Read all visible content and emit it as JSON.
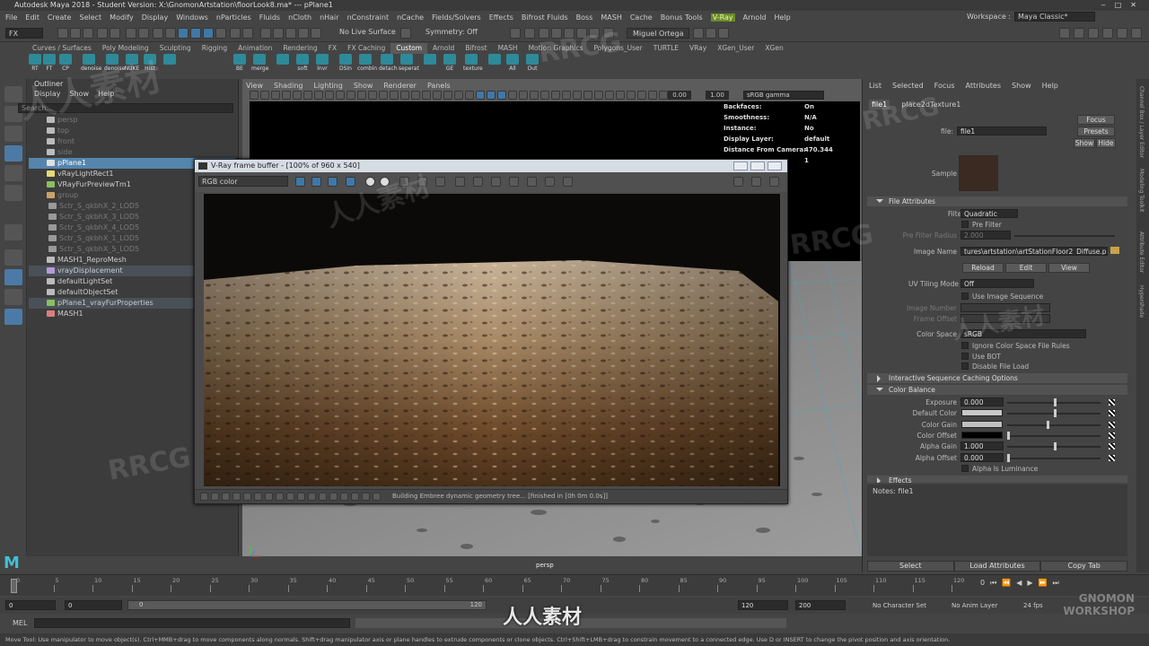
{
  "window": {
    "title": "Autodesk Maya 2018 - Student Version: X:\\GnomonArtstation\\floorLook8.ma*   ---   pPlane1"
  },
  "menus": [
    "File",
    "Edit",
    "Create",
    "Select",
    "Modify",
    "Display",
    "Windows",
    "nParticles",
    "Fluids",
    "nCloth",
    "nHair",
    "nConstraint",
    "nCache",
    "Fields/Solvers",
    "Effects",
    "Bifrost Fluids",
    "Boss",
    "MASH",
    "Cache",
    "Bonus Tools",
    "V-Ray",
    "Arnold",
    "Help"
  ],
  "workspace": {
    "label": "Workspace :",
    "value": "Maya Classic*"
  },
  "statusline": {
    "mode": "FX",
    "live_surface": "No Live Surface",
    "symmetry": "Symmetry: Off",
    "user": "Miguel Ortega"
  },
  "shelf": {
    "tabs": [
      "Curves / Surfaces",
      "Poly Modeling",
      "Sculpting",
      "Rigging",
      "Animation",
      "Rendering",
      "FX",
      "FX Caching",
      "Custom",
      "Arnold",
      "Bifrost",
      "MASH",
      "Motion Graphics",
      "Polygons_User",
      "TURTLE",
      "VRay",
      "XGen_User",
      "XGen"
    ],
    "active_tab": "Custom",
    "buttons": [
      "RT",
      "FT",
      "CP",
      "denoise",
      "denoise",
      "NUKE",
      "Hist",
      "",
      "BE",
      "merge",
      "",
      "soft",
      "lnvr",
      "DSIn",
      "combin",
      "detach",
      "seperat",
      "",
      "GE",
      "texture",
      "",
      "All",
      "Out"
    ]
  },
  "outliner": {
    "title": "Outliner",
    "menu": [
      "Display",
      "Show",
      "Help"
    ],
    "search_placeholder": "Search...",
    "items": [
      {
        "label": "persp",
        "indent": 1,
        "state": "dim",
        "color": "#bbbbbb"
      },
      {
        "label": "top",
        "indent": 1,
        "state": "dim",
        "color": "#bbbbbb"
      },
      {
        "label": "front",
        "indent": 1,
        "state": "dim",
        "color": "#bbbbbb"
      },
      {
        "label": "side",
        "indent": 1,
        "state": "dim",
        "color": "#bbbbbb"
      },
      {
        "label": "pPlane1",
        "indent": 1,
        "state": "selected",
        "color": "#e0e0e0"
      },
      {
        "label": "vRayLightRect1",
        "indent": 1,
        "state": "normal",
        "color": "#e8d77a"
      },
      {
        "label": "VRayFurPreviewTm1",
        "indent": 1,
        "state": "normal",
        "color": "#8ac060"
      },
      {
        "label": "group",
        "indent": 1,
        "state": "dim",
        "color": "#c9a26a"
      },
      {
        "label": "Sctr_S_qkbhX_2_LOD5",
        "indent": 2,
        "state": "dim",
        "color": "#999999"
      },
      {
        "label": "Sctr_S_qkbhX_3_LOD5",
        "indent": 2,
        "state": "dim",
        "color": "#999999"
      },
      {
        "label": "Sctr_S_qkbhX_4_LOD5",
        "indent": 2,
        "state": "dim",
        "color": "#999999"
      },
      {
        "label": "Sctr_S_qkbhX_1_LOD5",
        "indent": 2,
        "state": "dim",
        "color": "#999999"
      },
      {
        "label": "Sctr_S_qkbhX_5_LOD5",
        "indent": 2,
        "state": "dim",
        "color": "#999999"
      },
      {
        "label": "MASH1_ReproMesh",
        "indent": 1,
        "state": "normal",
        "color": "#bbbbbb"
      },
      {
        "label": "vrayDisplacement",
        "indent": 1,
        "state": "highlight",
        "color": "#b59bd6"
      },
      {
        "label": "defaultLightSet",
        "indent": 1,
        "state": "normal",
        "color": "#bbbbbb"
      },
      {
        "label": "defaultObjectSet",
        "indent": 1,
        "state": "normal",
        "color": "#bbbbbb"
      },
      {
        "label": "pPlane1_vrayFurProperties",
        "indent": 1,
        "state": "highlight",
        "color": "#8ac060"
      },
      {
        "label": "MASH1",
        "indent": 1,
        "state": "normal",
        "color": "#d97f7f"
      }
    ]
  },
  "viewport": {
    "menu": [
      "View",
      "Shading",
      "Lighting",
      "Show",
      "Renderer",
      "Panels"
    ],
    "value1": "0.00",
    "value2": "1.00",
    "color_space": "sRGB gamma",
    "hud": [
      {
        "label": "Backfaces:",
        "value": "On"
      },
      {
        "label": "Smoothness:",
        "value": "N/A"
      },
      {
        "label": "Instance:",
        "value": "No"
      },
      {
        "label": "Display Layer:",
        "value": "default"
      },
      {
        "label": "Distance From Camera:",
        "value": "470.344"
      },
      {
        "label": "",
        "value": "1"
      }
    ],
    "camera": "persp"
  },
  "vfb": {
    "title": "V-Ray frame buffer - [100% of 960 x 540]",
    "channel": "RGB color",
    "status": "Building Embree dynamic geometry tree... [finished in [0h  0m  0.0s]]"
  },
  "attribute_editor": {
    "menu": [
      "List",
      "Selected",
      "Focus",
      "Attributes",
      "Show",
      "Help"
    ],
    "tabs": [
      "file1",
      "place2dTexture1"
    ],
    "file_label": "file:",
    "file_value": "file1",
    "buttons": {
      "focus": "Focus",
      "presets": "Presets",
      "show": "Show",
      "hide": "Hide"
    },
    "sample_label": "Sample",
    "sample_color": "#3a2a22",
    "sections": {
      "file_attributes": "File Attributes",
      "interactive": "Interactive Sequence Caching Options",
      "color_balance": "Color Balance",
      "effects": "Effects"
    },
    "filter_type": {
      "label": "Filter Type",
      "value": "Quadratic"
    },
    "pre_filter": "Pre Filter",
    "pre_filter_radius": {
      "label": "Pre Filter Radius",
      "value": "2.000"
    },
    "image_name": {
      "label": "Image Name",
      "value": "tures\\artstation\\artStationFloor2_Diffuse.png"
    },
    "image_buttons": {
      "reload": "Reload",
      "edit": "Edit",
      "view": "View"
    },
    "uv_tiling": {
      "label": "UV Tiling Mode",
      "value": "Off"
    },
    "use_image_sequence": "Use Image Sequence",
    "image_number": "Image Number",
    "frame_offset": "Frame Offset",
    "color_space": {
      "label": "Color Space",
      "value": "sRGB"
    },
    "checkboxes": [
      "Ignore Color Space File Rules",
      "Use BOT",
      "Disable File Load"
    ],
    "color_balance": [
      {
        "label": "Exposure",
        "value": "0.000",
        "type": "field",
        "level": 1.0
      },
      {
        "label": "Default Color",
        "value": "",
        "type": "swatch",
        "color": "#c8c8c8",
        "level": 1.0
      },
      {
        "label": "Color Gain",
        "value": "",
        "type": "swatch",
        "color": "#c0c0c0",
        "level": 0.85
      },
      {
        "label": "Color Offset",
        "value": "",
        "type": "swatch",
        "color": "#000000",
        "level": 0.0
      },
      {
        "label": "Alpha Gain",
        "value": "1.000",
        "type": "field",
        "level": 1.0
      },
      {
        "label": "Alpha Offset",
        "value": "0.000",
        "type": "field",
        "level": 0.0
      }
    ],
    "alpha_is_luminance": "Alpha Is Luminance",
    "notes": "Notes:  file1",
    "bottom_buttons": [
      "Select",
      "Load Attributes",
      "Copy Tab"
    ]
  },
  "side_tabs": [
    "Channel Box / Layer Editor",
    "Modeling Toolkit",
    "Attribute Editor",
    "Hypershade"
  ],
  "timeline": {
    "ticks": [
      "0",
      "5",
      "10",
      "15",
      "20",
      "25",
      "30",
      "35",
      "40",
      "45",
      "50",
      "55",
      "60",
      "65",
      "70",
      "75",
      "80",
      "85",
      "90",
      "95",
      "100",
      "105",
      "110",
      "115",
      "120"
    ],
    "current": "0"
  },
  "range": {
    "start": "0",
    "start2": "0",
    "slider_start": "0",
    "slider_end": "120",
    "end": "120",
    "end2": "200",
    "character_set": "No Character Set",
    "anim_layer": "No Anim Layer",
    "fps": "24 fps"
  },
  "command_line": {
    "label": "MEL"
  },
  "help_line": "Move Tool: Use manipulator to move object(s). Ctrl+MMB+drag to move components along normals. Shift+drag manipulator axis or plane handles to extrude components or clone objects. Ctrl+Shift+LMB+drag to constrain movement to a connected edge. Use D or INSERT to change the pivot position and axis orientation.",
  "watermarks": [
    "RRCG",
    "人人素材",
    "RRCG",
    "人人素材",
    "RRCG",
    "RRCG",
    "人人素材"
  ],
  "footer_logo": "人人素材",
  "footer_brand": "GNOMON WORKSHOP"
}
